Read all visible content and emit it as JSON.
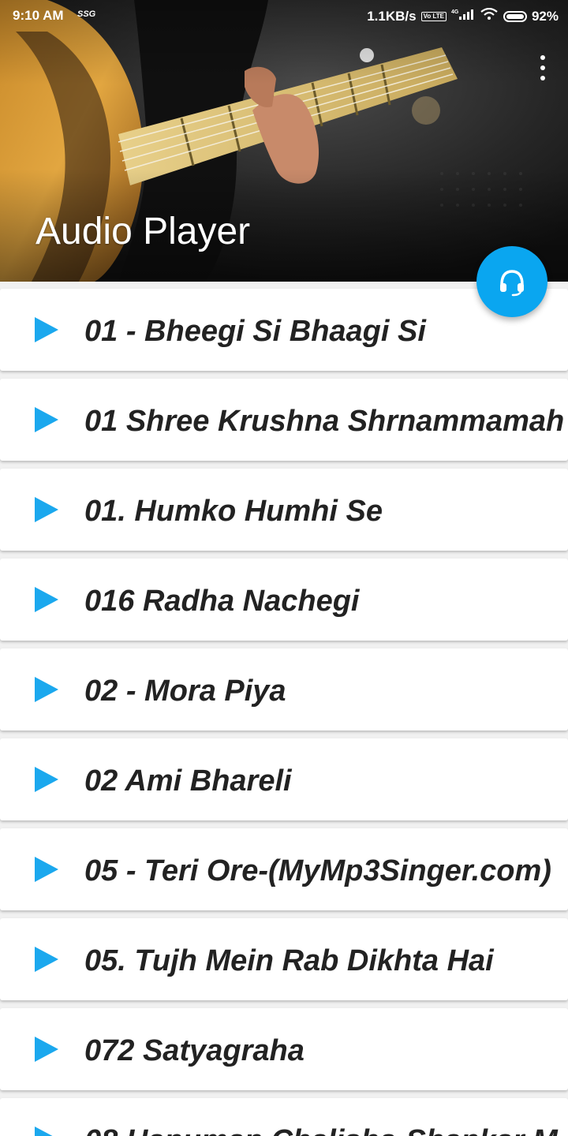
{
  "status_bar": {
    "time": "9:10 AM",
    "carrier": "SSG",
    "speed": "1.1KB/s",
    "volte": "Vo LTE",
    "network": "4G",
    "battery": "92%"
  },
  "header": {
    "title": "Audio Player",
    "background_icon": "guitar-photo"
  },
  "fab": {
    "icon": "headphones-icon",
    "color": "#0aa6f0"
  },
  "accent_color": "#1ba8ee",
  "songs": [
    {
      "title": "01 - Bheegi Si Bhaagi Si"
    },
    {
      "title": "01 Shree Krushna Shrnammamah"
    },
    {
      "title": "01. Humko Humhi Se"
    },
    {
      "title": "016 Radha Nachegi"
    },
    {
      "title": "02 - Mora Piya"
    },
    {
      "title": "02 Ami Bhareli"
    },
    {
      "title": "05 - Teri Ore-(MyMp3Singer.com)"
    },
    {
      "title": "05. Tujh Mein Rab Dikhta Hai"
    },
    {
      "title": "072 Satyagraha"
    },
    {
      "title": "08 Hanuman Chalisha-Shankar M"
    }
  ]
}
